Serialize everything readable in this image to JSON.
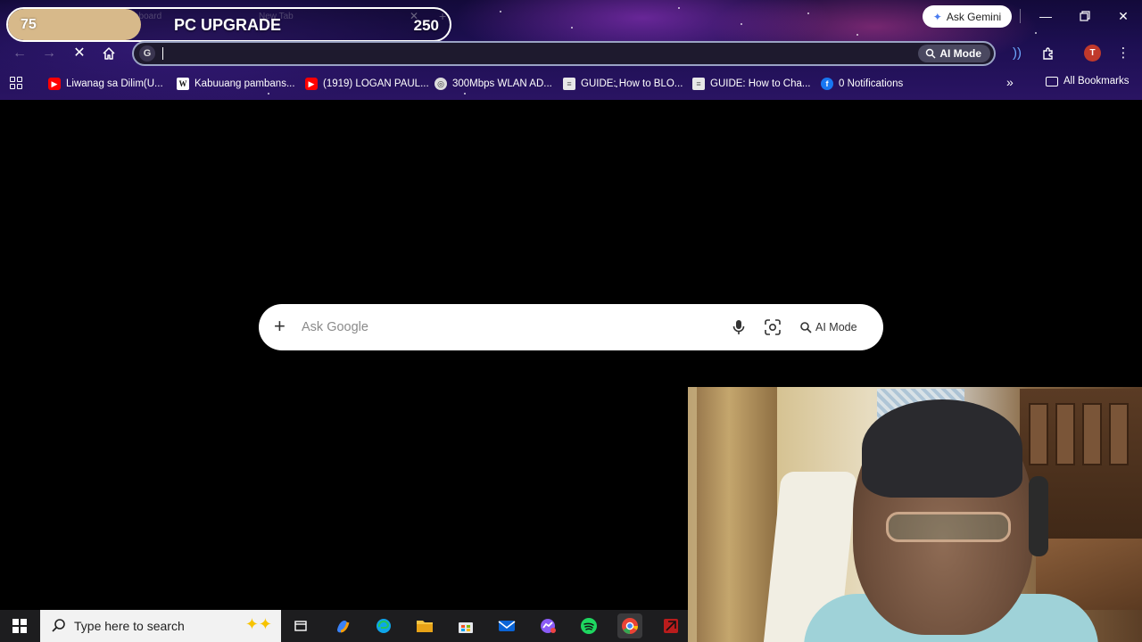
{
  "overlay": {
    "goal_title": "PC UPGRADE",
    "goal_current": "75",
    "goal_target": "250",
    "goal_fraction": 0.3,
    "fill_color": "#d7b98a"
  },
  "tabs": {
    "ghost_tab_1": "nboard",
    "ghost_tab_2": "New Tab"
  },
  "header": {
    "gemini_label": "Ask Gemini"
  },
  "omnibox": {
    "value": "",
    "ai_mode_label": "AI Mode"
  },
  "bookmarks": [
    {
      "label": "Liwanag sa Dilim(U...",
      "icon": "youtube-icon"
    },
    {
      "label": "Kabuuang pambans...",
      "icon": "wikipedia-icon"
    },
    {
      "label": "(1919) LOGAN PAUL...",
      "icon": "youtube-icon"
    },
    {
      "label": "300Mbps WLAN AD...",
      "icon": "globe-icon"
    },
    {
      "label": "GUIDE: How to BLO...",
      "icon": "document-icon"
    },
    {
      "label": "GUIDE: How to Cha...",
      "icon": "document-icon"
    },
    {
      "label": "0 Notifications",
      "icon": "facebook-icon"
    }
  ],
  "all_bookmarks_label": "All Bookmarks",
  "newtab": {
    "search_placeholder": "Ask Google",
    "ai_mode_label": "AI Mode"
  },
  "taskbar": {
    "search_placeholder": "Type here to search"
  },
  "profile_initial": "T",
  "colors": {
    "accent_blue": "#4a7cf0",
    "youtube_red": "#ff0000",
    "facebook_blue": "#1877f2",
    "taskbar_bg": "#1d1d1f"
  }
}
